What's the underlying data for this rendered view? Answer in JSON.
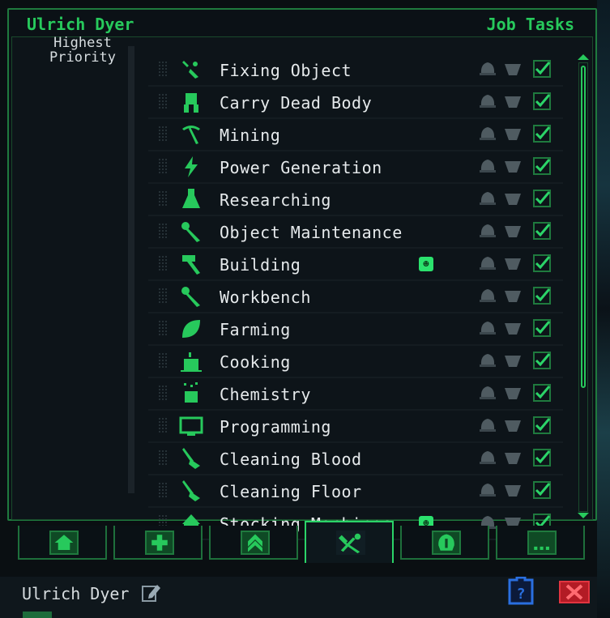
{
  "panel": {
    "character_name": "Ulrich Dyer",
    "title": "Job Tasks"
  },
  "priority": {
    "label": "Highest\nPriority"
  },
  "jobs": [
    {
      "label": "Fixing Object",
      "icon": "wrench-screw-icon",
      "enabled": true
    },
    {
      "label": "Carry Dead Body",
      "icon": "carry-body-icon",
      "enabled": true
    },
    {
      "label": "Mining",
      "icon": "pickaxe-icon",
      "enabled": true
    },
    {
      "label": "Power Generation",
      "icon": "lightning-icon",
      "enabled": true
    },
    {
      "label": "Researching",
      "icon": "flask-icon",
      "enabled": true
    },
    {
      "label": "Object Maintenance",
      "icon": "wrench-icon",
      "enabled": true
    },
    {
      "label": "Building",
      "icon": "hammer-icon",
      "enabled": true,
      "badge": "smiley"
    },
    {
      "label": "Workbench",
      "icon": "wrench-icon",
      "enabled": true
    },
    {
      "label": "Farming",
      "icon": "leaf-icon",
      "enabled": true
    },
    {
      "label": "Cooking",
      "icon": "pot-icon",
      "enabled": true
    },
    {
      "label": "Chemistry",
      "icon": "chemistry-pot-icon",
      "enabled": true
    },
    {
      "label": "Programming",
      "icon": "monitor-icon",
      "enabled": true
    },
    {
      "label": "Cleaning Blood",
      "icon": "mop-icon",
      "enabled": true
    },
    {
      "label": "Cleaning Floor",
      "icon": "mop-icon",
      "enabled": true
    },
    {
      "label": "Stocking Machines",
      "icon": "stock-icon",
      "enabled": true,
      "badge": "smiley"
    }
  ],
  "tabs": [
    {
      "icon": "home-icon"
    },
    {
      "icon": "medical-cross-icon"
    },
    {
      "icon": "rank-chevron-icon"
    },
    {
      "icon": "hammer-wrench-icon",
      "active": true
    },
    {
      "icon": "helmet-icon"
    },
    {
      "icon": "more-icon"
    }
  ],
  "footer": {
    "character_name": "Ulrich Dyer"
  },
  "colors": {
    "accent": "#27c95c",
    "text": "#e6eaec",
    "close": "#d0242e",
    "help": "#2a6fe0"
  }
}
